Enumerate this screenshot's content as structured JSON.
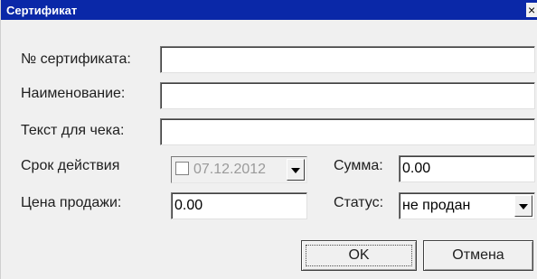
{
  "window": {
    "title": "Сертификат",
    "close_symbol": "×"
  },
  "form": {
    "certificate_number": {
      "label": "№ сертификата:",
      "value": ""
    },
    "name": {
      "label": "Наименование:",
      "value": ""
    },
    "receipt_text": {
      "label": "Текст для чека:",
      "value": ""
    },
    "validity": {
      "label": "Срок действия",
      "date": "07.12.2012",
      "enabled": false
    },
    "sum": {
      "label": "Сумма:",
      "value": "0.00"
    },
    "sale_price": {
      "label": "Цена продажи:",
      "value": "0.00"
    },
    "status": {
      "label": "Статус:",
      "selected": "не продан"
    }
  },
  "buttons": {
    "ok": "OK",
    "cancel": "Отмена"
  },
  "colors": {
    "titlebar": "#0a28a8",
    "window_bg": "#f0f0f0"
  }
}
